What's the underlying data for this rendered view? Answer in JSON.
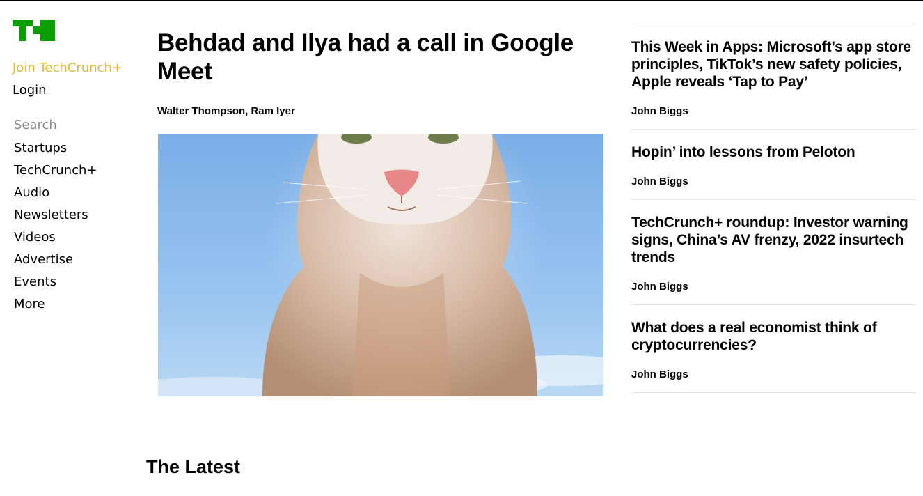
{
  "sidebar": {
    "logo_icon": "techcrunch-logo",
    "join_label": "Join TechCrunch+",
    "login_label": "Login",
    "search_placeholder": "Search",
    "nav_items": [
      "Startups",
      "TechCrunch+",
      "Audio",
      "Newsletters",
      "Videos",
      "Advertise",
      "Events",
      "More"
    ]
  },
  "main": {
    "headline": "Behdad and Ilya had a call in Google Meet",
    "byline": "Walter Thompson, Ram Iyer",
    "image": "kitten-photo",
    "latest_heading": "The Latest"
  },
  "right_column": {
    "stories": [
      {
        "title": "This Week in Apps: Microsoft’s app store principles, TikTok’s new safety policies, Apple reveals ‘Tap to Pay’",
        "author": "John Biggs"
      },
      {
        "title": "Hopin’ into lessons from Peloton",
        "author": "John Biggs"
      },
      {
        "title": "TechCrunch+ roundup: Investor warning signs, China’s AV frenzy, 2022 insurtech trends",
        "author": "John Biggs"
      },
      {
        "title": "What does a real economist think of cryptocurrencies?",
        "author": "John Biggs"
      }
    ]
  },
  "colors": {
    "brand_green": "#0a9e01",
    "join_accent": "#e6b832",
    "divider": "#e4e4e4"
  }
}
